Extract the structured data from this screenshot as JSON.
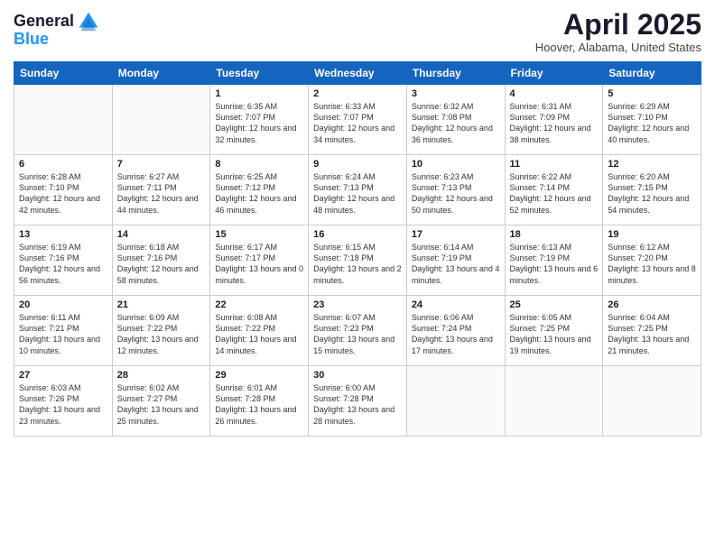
{
  "logo": {
    "general": "General",
    "blue": "Blue"
  },
  "title": "April 2025",
  "location": "Hoover, Alabama, United States",
  "days_of_week": [
    "Sunday",
    "Monday",
    "Tuesday",
    "Wednesday",
    "Thursday",
    "Friday",
    "Saturday"
  ],
  "weeks": [
    [
      {
        "day": "",
        "info": ""
      },
      {
        "day": "",
        "info": ""
      },
      {
        "day": "1",
        "info": "Sunrise: 6:35 AM\nSunset: 7:07 PM\nDaylight: 12 hours and 32 minutes."
      },
      {
        "day": "2",
        "info": "Sunrise: 6:33 AM\nSunset: 7:07 PM\nDaylight: 12 hours and 34 minutes."
      },
      {
        "day": "3",
        "info": "Sunrise: 6:32 AM\nSunset: 7:08 PM\nDaylight: 12 hours and 36 minutes."
      },
      {
        "day": "4",
        "info": "Sunrise: 6:31 AM\nSunset: 7:09 PM\nDaylight: 12 hours and 38 minutes."
      },
      {
        "day": "5",
        "info": "Sunrise: 6:29 AM\nSunset: 7:10 PM\nDaylight: 12 hours and 40 minutes."
      }
    ],
    [
      {
        "day": "6",
        "info": "Sunrise: 6:28 AM\nSunset: 7:10 PM\nDaylight: 12 hours and 42 minutes."
      },
      {
        "day": "7",
        "info": "Sunrise: 6:27 AM\nSunset: 7:11 PM\nDaylight: 12 hours and 44 minutes."
      },
      {
        "day": "8",
        "info": "Sunrise: 6:25 AM\nSunset: 7:12 PM\nDaylight: 12 hours and 46 minutes."
      },
      {
        "day": "9",
        "info": "Sunrise: 6:24 AM\nSunset: 7:13 PM\nDaylight: 12 hours and 48 minutes."
      },
      {
        "day": "10",
        "info": "Sunrise: 6:23 AM\nSunset: 7:13 PM\nDaylight: 12 hours and 50 minutes."
      },
      {
        "day": "11",
        "info": "Sunrise: 6:22 AM\nSunset: 7:14 PM\nDaylight: 12 hours and 52 minutes."
      },
      {
        "day": "12",
        "info": "Sunrise: 6:20 AM\nSunset: 7:15 PM\nDaylight: 12 hours and 54 minutes."
      }
    ],
    [
      {
        "day": "13",
        "info": "Sunrise: 6:19 AM\nSunset: 7:16 PM\nDaylight: 12 hours and 56 minutes."
      },
      {
        "day": "14",
        "info": "Sunrise: 6:18 AM\nSunset: 7:16 PM\nDaylight: 12 hours and 58 minutes."
      },
      {
        "day": "15",
        "info": "Sunrise: 6:17 AM\nSunset: 7:17 PM\nDaylight: 13 hours and 0 minutes."
      },
      {
        "day": "16",
        "info": "Sunrise: 6:15 AM\nSunset: 7:18 PM\nDaylight: 13 hours and 2 minutes."
      },
      {
        "day": "17",
        "info": "Sunrise: 6:14 AM\nSunset: 7:19 PM\nDaylight: 13 hours and 4 minutes."
      },
      {
        "day": "18",
        "info": "Sunrise: 6:13 AM\nSunset: 7:19 PM\nDaylight: 13 hours and 6 minutes."
      },
      {
        "day": "19",
        "info": "Sunrise: 6:12 AM\nSunset: 7:20 PM\nDaylight: 13 hours and 8 minutes."
      }
    ],
    [
      {
        "day": "20",
        "info": "Sunrise: 6:11 AM\nSunset: 7:21 PM\nDaylight: 13 hours and 10 minutes."
      },
      {
        "day": "21",
        "info": "Sunrise: 6:09 AM\nSunset: 7:22 PM\nDaylight: 13 hours and 12 minutes."
      },
      {
        "day": "22",
        "info": "Sunrise: 6:08 AM\nSunset: 7:22 PM\nDaylight: 13 hours and 14 minutes."
      },
      {
        "day": "23",
        "info": "Sunrise: 6:07 AM\nSunset: 7:23 PM\nDaylight: 13 hours and 15 minutes."
      },
      {
        "day": "24",
        "info": "Sunrise: 6:06 AM\nSunset: 7:24 PM\nDaylight: 13 hours and 17 minutes."
      },
      {
        "day": "25",
        "info": "Sunrise: 6:05 AM\nSunset: 7:25 PM\nDaylight: 13 hours and 19 minutes."
      },
      {
        "day": "26",
        "info": "Sunrise: 6:04 AM\nSunset: 7:25 PM\nDaylight: 13 hours and 21 minutes."
      }
    ],
    [
      {
        "day": "27",
        "info": "Sunrise: 6:03 AM\nSunset: 7:26 PM\nDaylight: 13 hours and 23 minutes."
      },
      {
        "day": "28",
        "info": "Sunrise: 6:02 AM\nSunset: 7:27 PM\nDaylight: 13 hours and 25 minutes."
      },
      {
        "day": "29",
        "info": "Sunrise: 6:01 AM\nSunset: 7:28 PM\nDaylight: 13 hours and 26 minutes."
      },
      {
        "day": "30",
        "info": "Sunrise: 6:00 AM\nSunset: 7:28 PM\nDaylight: 13 hours and 28 minutes."
      },
      {
        "day": "",
        "info": ""
      },
      {
        "day": "",
        "info": ""
      },
      {
        "day": "",
        "info": ""
      }
    ]
  ]
}
